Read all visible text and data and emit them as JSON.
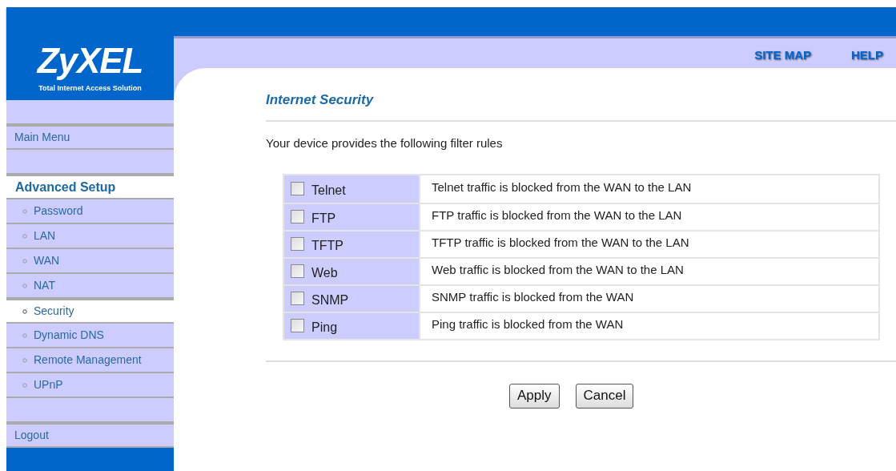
{
  "logo": {
    "name": "ZyXEL",
    "tagline": "Total Internet Access Solution"
  },
  "top_links": [
    "SITE MAP",
    "HELP"
  ],
  "sidebar": {
    "items": [
      {
        "kind": "blank"
      },
      {
        "kind": "link",
        "label": "Main Menu",
        "selected": false
      },
      {
        "kind": "blank"
      },
      {
        "kind": "header",
        "label": "Advanced Setup",
        "selected": true
      },
      {
        "kind": "sub",
        "label": "Password",
        "selected": false
      },
      {
        "kind": "sub",
        "label": "LAN",
        "selected": false
      },
      {
        "kind": "sub",
        "label": "WAN",
        "selected": false
      },
      {
        "kind": "sub",
        "label": "NAT",
        "selected": false
      },
      {
        "kind": "sub",
        "label": "Security",
        "selected": true
      },
      {
        "kind": "sub",
        "label": "Dynamic DNS",
        "selected": false
      },
      {
        "kind": "sub",
        "label": "Remote Management",
        "selected": false
      },
      {
        "kind": "sub",
        "label": "UPnP",
        "selected": false
      },
      {
        "kind": "blank"
      },
      {
        "kind": "link",
        "label": "Logout",
        "selected": false
      }
    ]
  },
  "page_title": "Internet Security",
  "intro": "Your device provides the following filter rules",
  "rules": [
    {
      "name": "Telnet",
      "checked": false,
      "description": "Telnet traffic is blocked from the WAN to the LAN"
    },
    {
      "name": "FTP",
      "checked": false,
      "description": "FTP traffic is blocked from the WAN to the LAN"
    },
    {
      "name": "TFTP",
      "checked": false,
      "description": "TFTP traffic is blocked from the WAN to the LAN"
    },
    {
      "name": "Web",
      "checked": false,
      "description": "Web traffic is blocked from the WAN to the LAN"
    },
    {
      "name": "SNMP",
      "checked": false,
      "description": "SNMP traffic is blocked from the WAN"
    },
    {
      "name": "Ping",
      "checked": false,
      "description": "Ping traffic is blocked from the WAN"
    }
  ],
  "buttons": [
    "Apply",
    "Cancel"
  ]
}
